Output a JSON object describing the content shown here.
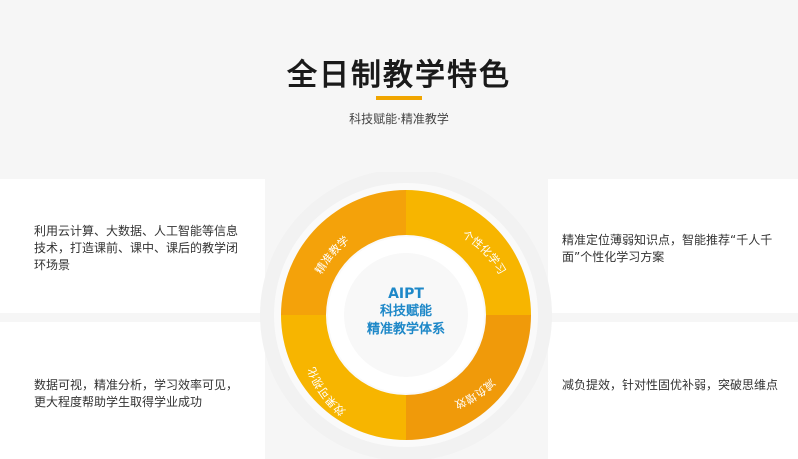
{
  "header": {
    "title": "全日制教学特色",
    "subtitle": "科技赋能·精准教学"
  },
  "cards": {
    "top_left": "利用云计算、大数据、人工智能等信息技术，打造课前、课中、课后的教学闭环场景",
    "bottom_left": "数据可视，精准分析，学习效率可见，更大程度帮助学生取得学业成功",
    "top_right": "精准定位薄弱知识点，智能推荐“千人千面”个性化学习方案",
    "bottom_right": "减负提效，针对性固优补弱，突破思维点"
  },
  "ring": {
    "center_line1": "AIPT",
    "center_line2": "科技赋能",
    "center_line3": "精准教学体系",
    "segments": [
      "精准教学",
      "个性化学习",
      "减负增效",
      "效果可视化"
    ],
    "colors": {
      "segment_dark": "#f09a0a",
      "segment_light": "#f7b500",
      "accent": "#1e88c8"
    }
  }
}
